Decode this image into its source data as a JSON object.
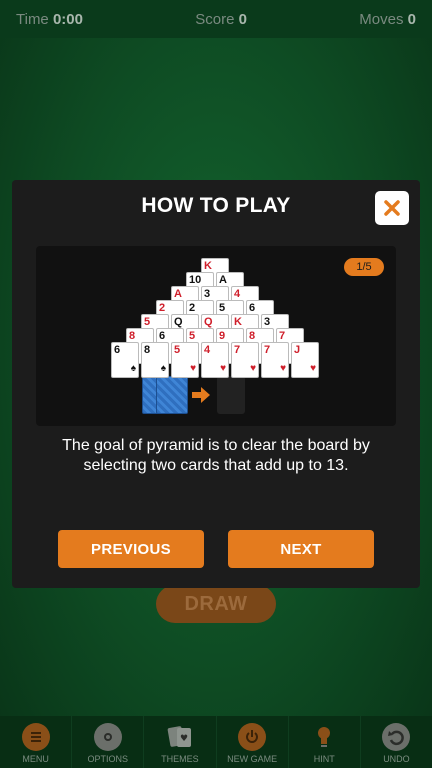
{
  "topbar": {
    "time_label": "Time",
    "time_value": "0:00",
    "score_label": "Score",
    "score_value": "0",
    "moves_label": "Moves",
    "moves_value": "0"
  },
  "draw_label": "DRAW",
  "bottombar": {
    "items": [
      {
        "label": "MENU",
        "icon": "menu-icon"
      },
      {
        "label": "OPTIONS",
        "icon": "gear-icon"
      },
      {
        "label": "THEMES",
        "icon": "cards-icon"
      },
      {
        "label": "NEW GAME",
        "icon": "power-icon"
      },
      {
        "label": "HINT",
        "icon": "lightbulb-icon"
      },
      {
        "label": "UNDO",
        "icon": "undo-icon"
      }
    ]
  },
  "modal": {
    "title": "HOW TO PLAY",
    "page_indicator": "1/5",
    "text": "The goal of pyramid is to clear the board by selecting two cards that add up to 13.",
    "previous_label": "PREVIOUS",
    "next_label": "NEXT",
    "accent_color": "#e47b1e"
  },
  "pyramid": {
    "rows": [
      [
        "K"
      ],
      [
        "10",
        "A"
      ],
      [
        "A",
        "3",
        "4"
      ],
      [
        "2",
        "2",
        "5",
        "6"
      ],
      [
        "5",
        "Q",
        "Q",
        "K",
        "3"
      ],
      [
        "8",
        "6",
        "5",
        "9",
        "8",
        "7"
      ],
      [
        "6",
        "8",
        "5",
        "4",
        "7",
        "7",
        "J"
      ]
    ],
    "colors": [
      [
        "red"
      ],
      [
        "black",
        "black"
      ],
      [
        "red",
        "black",
        "red"
      ],
      [
        "red",
        "black",
        "black",
        "black"
      ],
      [
        "red",
        "black",
        "red",
        "red",
        "black"
      ],
      [
        "red",
        "black",
        "red",
        "red",
        "red",
        "red"
      ],
      [
        "black",
        "black",
        "red",
        "red",
        "red",
        "red",
        "red"
      ]
    ]
  }
}
